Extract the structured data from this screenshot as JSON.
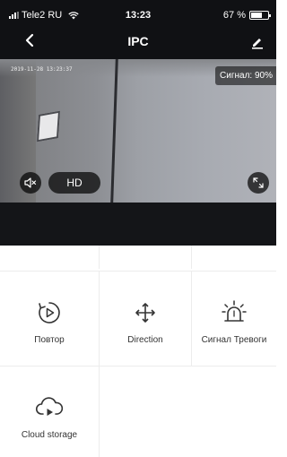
{
  "status_bar": {
    "carrier": "Tele2 RU",
    "time": "13:23",
    "battery": "67 %",
    "battery_level": 0.67
  },
  "nav": {
    "title": "IPC",
    "back_icon": "chevron-left-icon",
    "edit_icon": "pencil-icon"
  },
  "video": {
    "timestamp": "2019-11-28 13:23:37",
    "signal": "Сигнал: 90%",
    "quality": "HD",
    "mute_icon": "speaker-muted-icon",
    "fullscreen_icon": "fullscreen-icon"
  },
  "actions": [
    {
      "label": "Повтор",
      "icon": "playback-icon"
    },
    {
      "label": "Direction",
      "icon": "move-arrows-icon"
    },
    {
      "label": "Сигнал Тревоги",
      "icon": "alarm-siren-icon"
    },
    {
      "label": "Cloud storage",
      "icon": "cloud-play-icon"
    }
  ],
  "colors": {
    "bar_background": "#101114",
    "grid_divider": "#ececec",
    "icon_color": "#333333"
  }
}
